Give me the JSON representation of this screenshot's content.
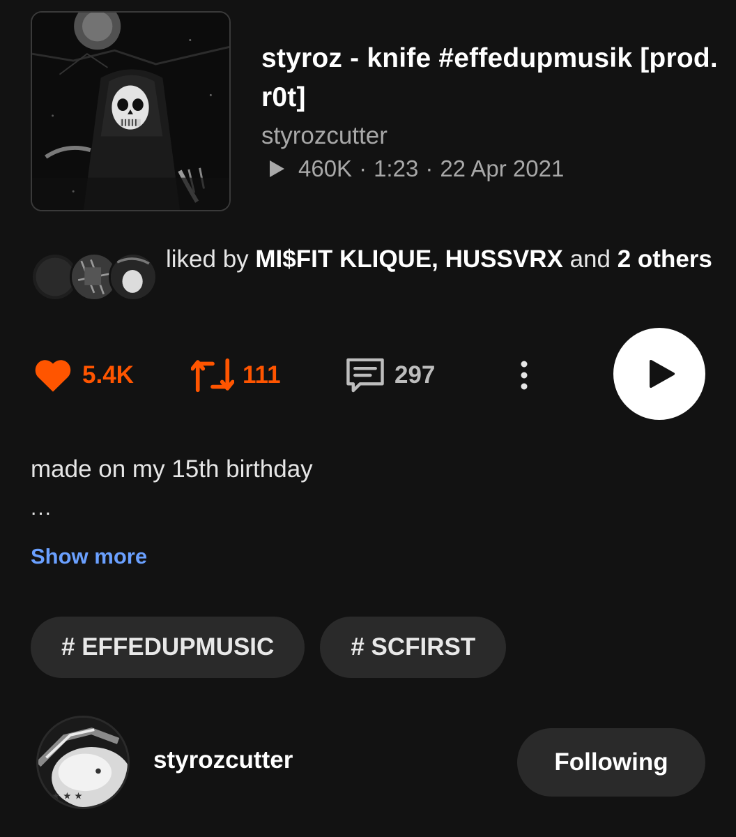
{
  "track": {
    "title": "styroz  - knife #effedupmusik [prod. r0t]",
    "artist": "styrozcutter",
    "plays": "460K",
    "duration": "1:23",
    "date": "22 Apr 2021",
    "separator": "·",
    "artwork_icon": "skull-reaper-artwork"
  },
  "liked_by": {
    "prefix": "liked by",
    "names": "MI$FIT KLIQUE, HUSSVRX",
    "conjunction": "and",
    "others": "2 others",
    "avatar_count": 3
  },
  "actions": {
    "likes": "5.4K",
    "reposts": "111",
    "comments": "297",
    "like_icon": "heart-icon",
    "repost_icon": "repost-icon",
    "comment_icon": "comment-icon",
    "more_icon": "more-vertical-icon",
    "play_icon": "play-icon"
  },
  "description": {
    "text": "made on my 15th birthday",
    "ellipsis": "...",
    "show_more": "Show more"
  },
  "tags": [
    "# EFFEDUPMUSIC",
    "# SCFIRST"
  ],
  "uploader": {
    "name": "styrozcutter",
    "follow_label": "Following"
  },
  "colors": {
    "background": "#121212",
    "accent": "#ff5500",
    "link": "#6aa0ff",
    "muted": "#a8a8a8",
    "pill": "#2a2a2a"
  }
}
